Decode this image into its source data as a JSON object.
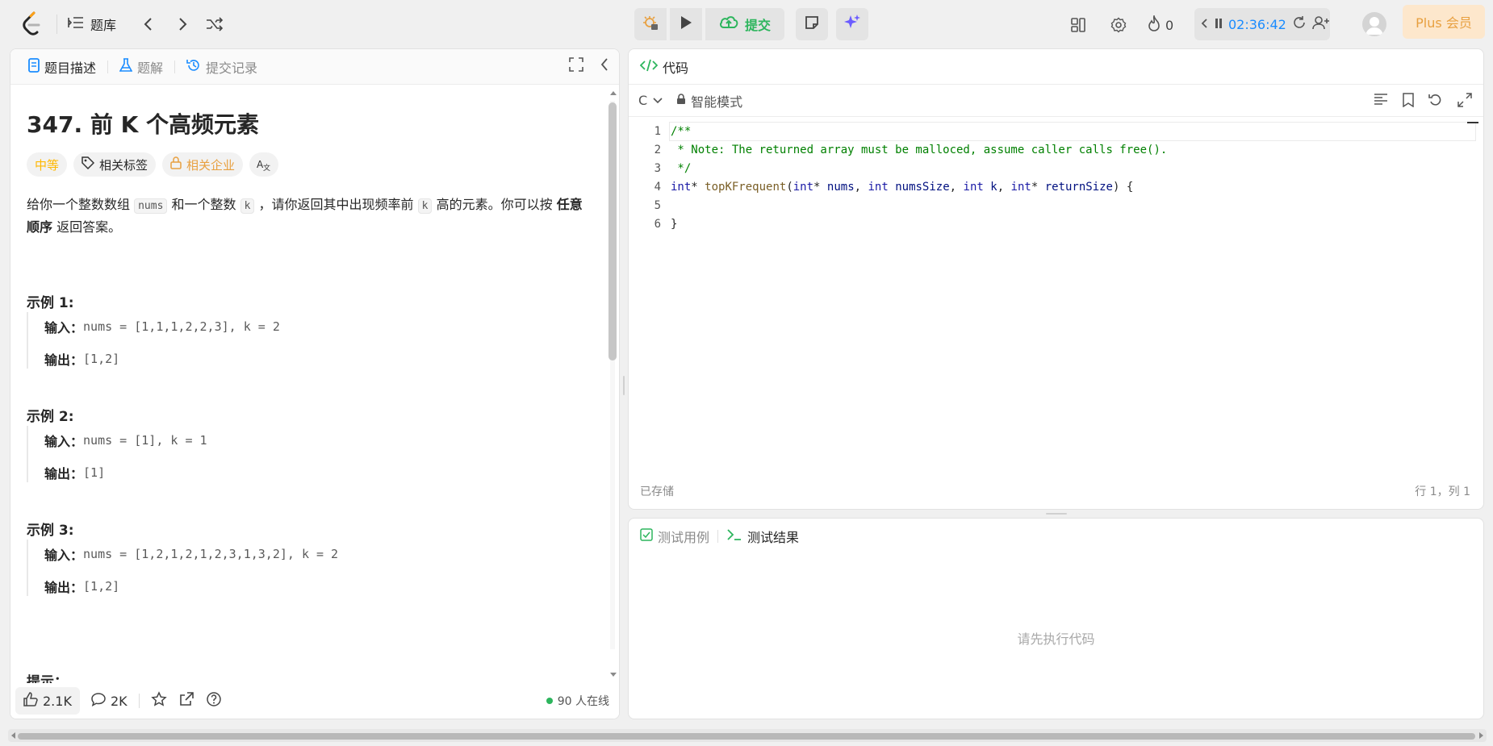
{
  "nav": {
    "problem_list": "题库",
    "submit": "提交",
    "streak": "0",
    "timer": "02:36:42",
    "plus": "Plus 会员"
  },
  "left": {
    "tabs": [
      "题目描述",
      "题解",
      "提交记录"
    ],
    "title": "347. 前 K 个高频元素",
    "tags": [
      "中等",
      "相关标签",
      "相关企业",
      "Aあ"
    ],
    "para": {
      "p1": "给你一个整数数组",
      "c1": "nums",
      "p2": "和一个整数",
      "c2": "k",
      "p3": "，请你返回其中出现频率前",
      "c3": "k",
      "p4": "高的元素。你可以按",
      "bold": "任意顺序",
      "p5": "返回答案。"
    },
    "examples": [
      {
        "title": "示例 1:",
        "input_label": "输入：",
        "input": "nums = [1,1,1,2,2,3], k = 2",
        "output_label": "输出：",
        "output": "[1,2]"
      },
      {
        "title": "示例 2:",
        "input_label": "输入：",
        "input": "nums = [1], k = 1",
        "output_label": "输出：",
        "output": "[1]"
      },
      {
        "title": "示例 3:",
        "input_label": "输入：",
        "input": "nums = [1,2,1,2,1,2,3,1,3,2], k = 2",
        "output_label": "输出：",
        "output": "[1,2]"
      }
    ],
    "hint": "提示：",
    "likes": "2.1K",
    "comments": "2K",
    "online": "90 人在线"
  },
  "code": {
    "title": "代码",
    "lang": "C",
    "mode": "智能模式",
    "lines": [
      "1",
      "2",
      "3",
      "4",
      "5",
      "6"
    ],
    "code_line1": "/**",
    "code_line2": " * Note: The returned array must be malloced, assume caller calls free().",
    "code_line3": " */",
    "code_line4_kw1": "int",
    "code_line4_p1": "* ",
    "code_line4_fn": "topKFrequent",
    "code_line4_p2": "(",
    "code_line4_kw2": "int",
    "code_line4_p3": "* ",
    "code_line4_v1": "nums",
    "code_line4_p4": ", ",
    "code_line4_kw3": "int",
    "code_line4_v2": "numsSize",
    "code_line4_p5": ", ",
    "code_line4_kw4": "int",
    "code_line4_v3": "k",
    "code_line4_p6": ", ",
    "code_line4_kw5": "int",
    "code_line4_p7": "* ",
    "code_line4_v4": "returnSize",
    "code_line4_p8": ") {",
    "code_line6": "}",
    "saved": "已存储",
    "cursor": "行 1，列 1"
  },
  "test": {
    "tab1": "测试用例",
    "tab2": "测试结果",
    "placeholder": "请先执行代码"
  }
}
